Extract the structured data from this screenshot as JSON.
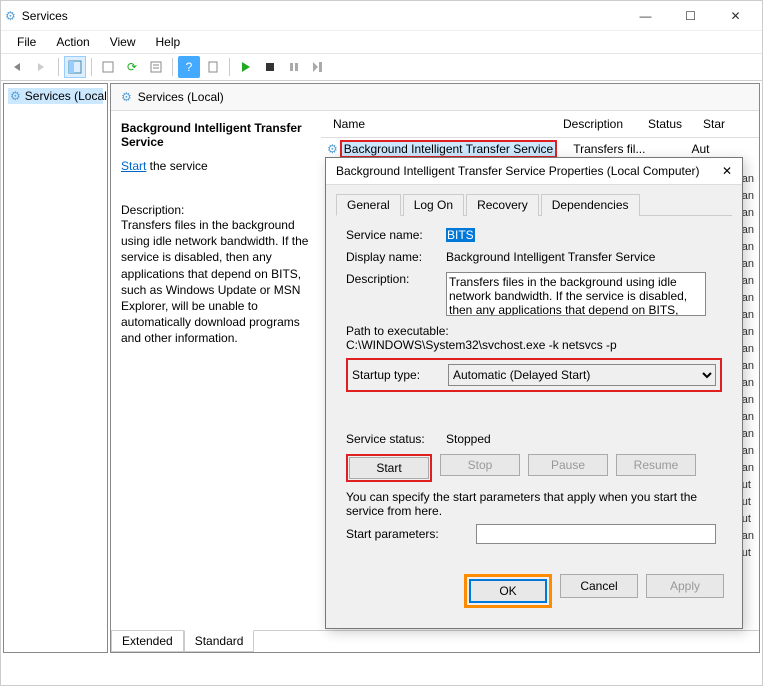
{
  "window": {
    "title": "Services"
  },
  "menu": {
    "file": "File",
    "action": "Action",
    "view": "View",
    "help": "Help"
  },
  "tree": {
    "root": "Services (Local)"
  },
  "content": {
    "heading": "Services (Local)"
  },
  "detail": {
    "service_name": "Background Intelligent Transfer Service",
    "start_link": "Start",
    "start_suffix": " the service",
    "desc_label": "Description:",
    "desc_text": "Transfers files in the background using idle network bandwidth. If the service is disabled, then any applications that depend on BITS, such as Windows Update or MSN Explorer, will be unable to automatically download programs and other information."
  },
  "list": {
    "columns": {
      "name": "Name",
      "description": "Description",
      "status": "Status",
      "startup": "Star"
    },
    "row": {
      "name": "Background Intelligent Transfer Service",
      "description": "Transfers fil...",
      "status": "",
      "startup": "Aut"
    }
  },
  "bottom_tabs": {
    "extended": "Extended",
    "standard": "Standard"
  },
  "dialog": {
    "title": "Background Intelligent Transfer Service Properties (Local Computer)",
    "tabs": {
      "general": "General",
      "logon": "Log On",
      "recovery": "Recovery",
      "dependencies": "Dependencies"
    },
    "labels": {
      "service_name": "Service name:",
      "display_name": "Display name:",
      "description": "Description:",
      "path_label": "Path to executable:",
      "startup_type": "Startup type:",
      "service_status": "Service status:",
      "start_params": "Start parameters:"
    },
    "values": {
      "service_name": "BITS",
      "display_name": "Background Intelligent Transfer Service",
      "description": "Transfers files in the background using idle network bandwidth. If the service is disabled, then any applications that depend on BITS, such as Windows",
      "path": "C:\\WINDOWS\\System32\\svchost.exe -k netsvcs -p",
      "startup_selected": "Automatic (Delayed Start)",
      "status": "Stopped",
      "note": "You can specify the start parameters that apply when you start the service from here."
    },
    "buttons": {
      "start": "Start",
      "stop": "Stop",
      "pause": "Pause",
      "resume": "Resume",
      "ok": "OK",
      "cancel": "Cancel",
      "apply": "Apply"
    }
  },
  "visible_startup_col": [
    "an",
    "an",
    "an",
    "an",
    "an",
    "an",
    "an",
    "an",
    "an",
    "an",
    "an",
    "an",
    "an",
    "an",
    "an",
    "an",
    "an",
    "an",
    "ut",
    "ut",
    "ut",
    "an",
    "ut"
  ]
}
